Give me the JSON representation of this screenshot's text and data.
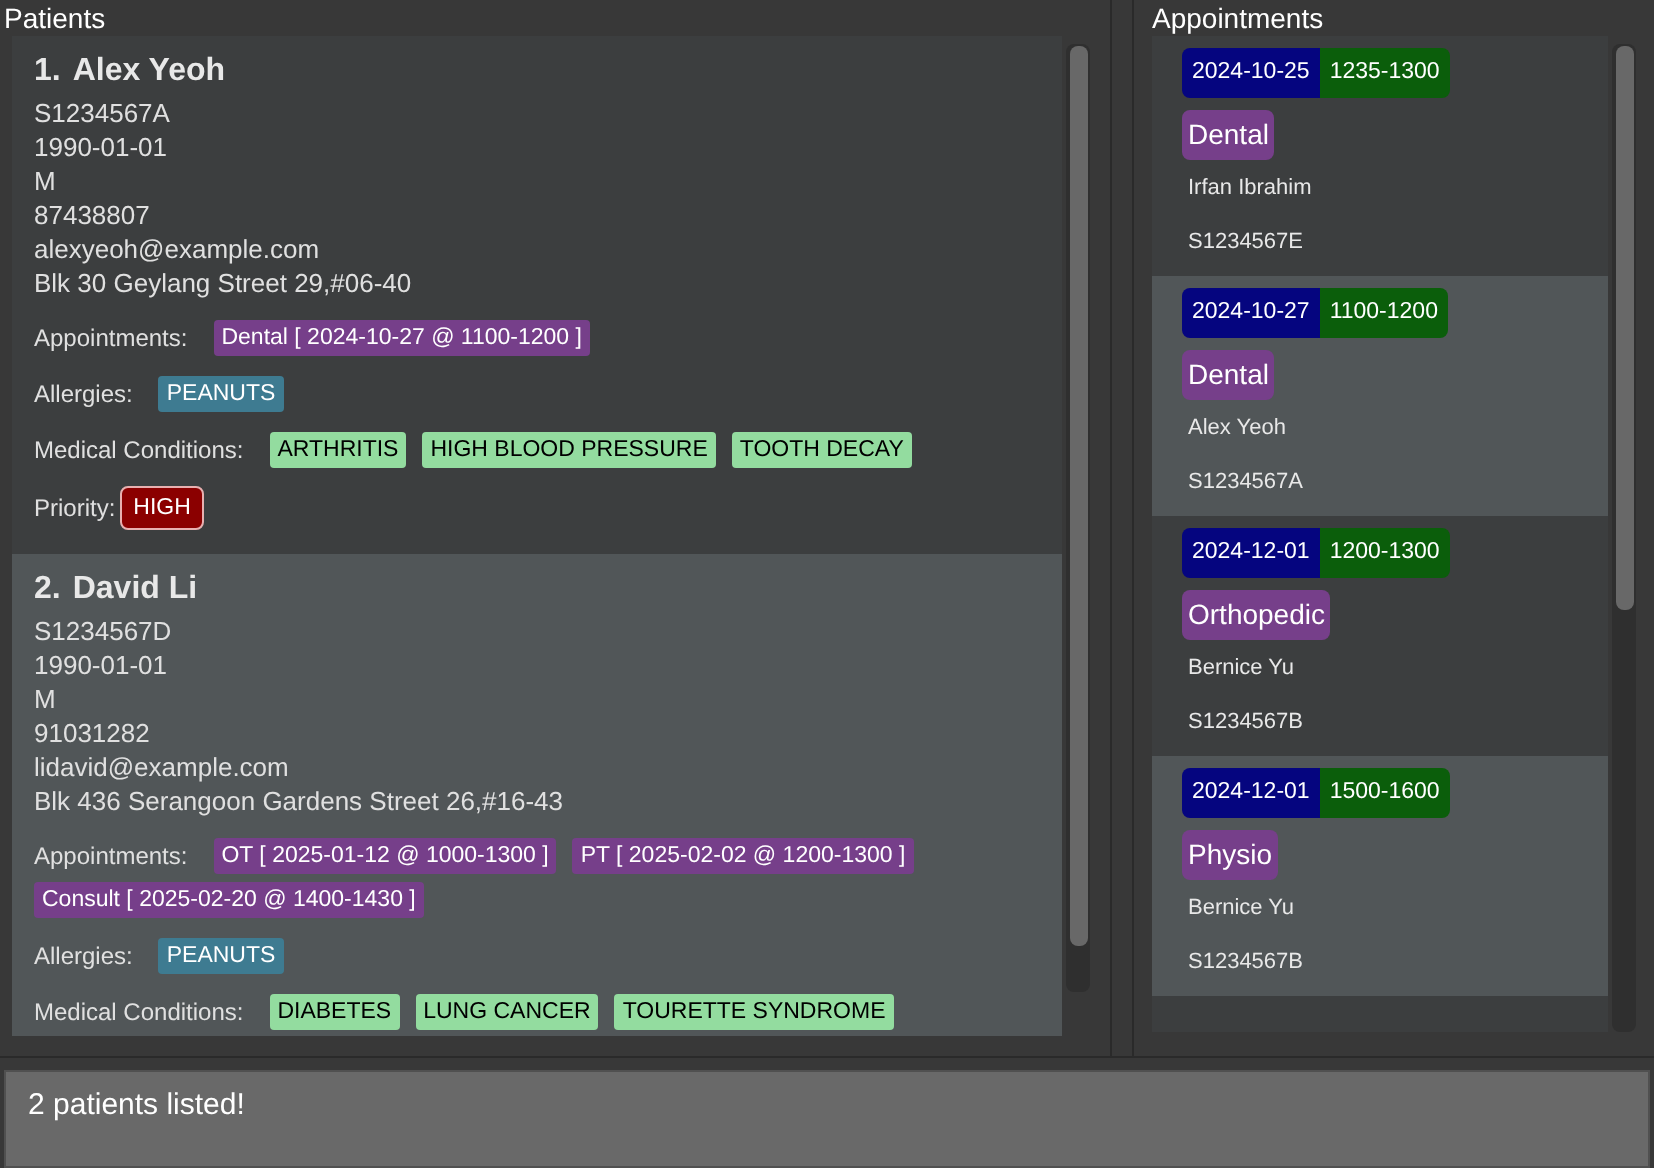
{
  "patients_panel": {
    "title": "Patients",
    "patients": [
      {
        "index": "1.",
        "name": "Alex Yeoh",
        "nric": "S1234567A",
        "birth_date": "1990-01-01",
        "sex": "M",
        "phone": "87438807",
        "email": "alexyeoh@example.com",
        "address": "Blk 30 Geylang Street 29,#06-40",
        "appointments_label": "Appointments:",
        "appointments": [
          "Dental [ 2024-10-27 @ 1100-1200 ]"
        ],
        "allergies_label": "Allergies:",
        "allergies": [
          "PEANUTS"
        ],
        "conditions_label": "Medical Conditions:",
        "conditions": [
          "ARTHRITIS",
          "HIGH BLOOD PRESSURE",
          "TOOTH DECAY"
        ],
        "priority_label": "Priority:",
        "priority": "HIGH"
      },
      {
        "index": "2.",
        "name": "David Li",
        "nric": "S1234567D",
        "birth_date": "1990-01-01",
        "sex": "M",
        "phone": "91031282",
        "email": "lidavid@example.com",
        "address": "Blk 436 Serangoon Gardens Street 26,#16-43",
        "appointments_label": "Appointments:",
        "appointments": [
          "OT [ 2025-01-12 @ 1000-1300 ]",
          "PT [ 2025-02-02 @ 1200-1300 ]",
          "Consult [ 2025-02-20 @ 1400-1430 ]"
        ],
        "allergies_label": "Allergies:",
        "allergies": [
          "PEANUTS"
        ],
        "conditions_label": "Medical Conditions:",
        "conditions": [
          "DIABETES",
          "LUNG CANCER",
          "TOURETTE SYNDROME"
        ]
      }
    ]
  },
  "appointments_panel": {
    "title": "Appointments",
    "appointments": [
      {
        "date": "2024-10-25",
        "time": "1235-1300",
        "type": "Dental",
        "patient": "Irfan Ibrahim",
        "nric": "S1234567E"
      },
      {
        "date": "2024-10-27",
        "time": "1100-1200",
        "type": "Dental",
        "patient": "Alex Yeoh",
        "nric": "S1234567A"
      },
      {
        "date": "2024-12-01",
        "time": "1200-1300",
        "type": "Orthopedic",
        "patient": "Bernice Yu",
        "nric": "S1234567B"
      },
      {
        "date": "2024-12-01",
        "time": "1500-1600",
        "type": "Physio",
        "patient": "Bernice Yu",
        "nric": "S1234567B"
      }
    ]
  },
  "result_display": {
    "text": "2 patients listed!"
  }
}
